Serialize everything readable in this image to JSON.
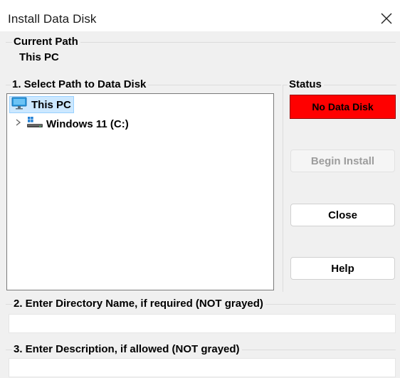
{
  "window": {
    "title": "Install Data Disk"
  },
  "current_path": {
    "heading": "Current Path",
    "value": "This PC"
  },
  "select_path": {
    "heading": "1. Select Path to Data Disk",
    "tree": {
      "root": {
        "label": "This PC",
        "icon": "monitor-icon",
        "selected": true
      },
      "children": [
        {
          "label": "Windows 11 (C:)",
          "icon": "drive-icon",
          "expander": "chevron-right-icon"
        }
      ]
    }
  },
  "status": {
    "heading": "Status",
    "value": "No Data Disk",
    "color": "#ff0000"
  },
  "buttons": {
    "begin_install": "Begin Install",
    "close": "Close",
    "help": "Help"
  },
  "directory": {
    "heading": "2. Enter Directory Name, if required (NOT grayed)",
    "value": ""
  },
  "description": {
    "heading": "3. Enter Description, if allowed (NOT grayed)",
    "value": ""
  },
  "colors": {
    "selection_bg": "#cce8ff",
    "status_red": "#ff0000",
    "disabled_text": "#9d9d9d"
  }
}
